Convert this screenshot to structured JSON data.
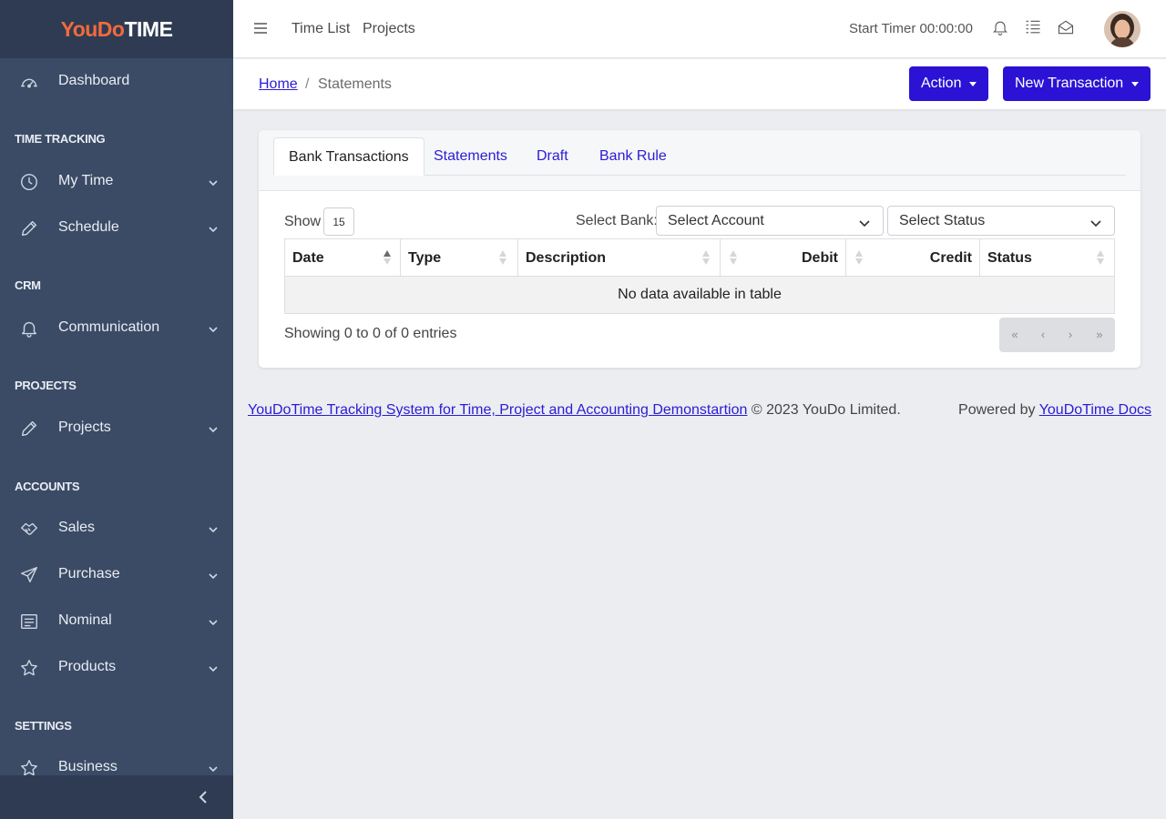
{
  "brand": {
    "part1": "YouDo",
    "part2": "TIME"
  },
  "sidebar": {
    "dashboard": "Dashboard",
    "sections": {
      "time_tracking": "TIME TRACKING",
      "crm": "CRM",
      "projects": "PROJECTS",
      "accounts": "ACCOUNTS",
      "settings": "SETTINGS"
    },
    "items": {
      "my_time": "My Time",
      "schedule": "Schedule",
      "communication": "Communication",
      "projects": "Projects",
      "sales": "Sales",
      "purchase": "Purchase",
      "nominal": "Nominal",
      "products": "Products",
      "business": "Business"
    }
  },
  "topbar": {
    "links": [
      "Time List",
      "Projects"
    ],
    "timer_label": "Start Timer",
    "timer_value": "00:00:00"
  },
  "breadcrumb": {
    "home": "Home",
    "separator": "/",
    "current": "Statements"
  },
  "buttons": {
    "action": "Action",
    "new_transaction": "New Transaction"
  },
  "tabs": [
    "Bank Transactions",
    "Statements",
    "Draft",
    "Bank Rule"
  ],
  "filters": {
    "show_label": "Show",
    "show_value": "15",
    "bank_label": "Select Bank:",
    "account_select": "Select Account",
    "status_select": "Select Status"
  },
  "table": {
    "columns": [
      "Date",
      "Type",
      "Description",
      "Debit",
      "Credit",
      "Status"
    ],
    "empty_message": "No data available in table"
  },
  "pagination": {
    "info": "Showing 0 to 0 of 0 entries",
    "first": "«",
    "prev": "‹",
    "next": "›",
    "last": "»"
  },
  "footer": {
    "link_text": "YouDoTime Tracking System for Time, Project and Accounting Demonstartion",
    "copyright": "© 2023 YouDo Limited.",
    "powered_by": "Powered by",
    "docs_link": "YouDoTime Docs"
  },
  "colors": {
    "sidebar_bg": "#3b4b66",
    "sidebar_header_bg": "#2e3b52",
    "brand_accent": "#f26a3c",
    "primary": "#2b12d4",
    "link": "#2b1bd6"
  }
}
